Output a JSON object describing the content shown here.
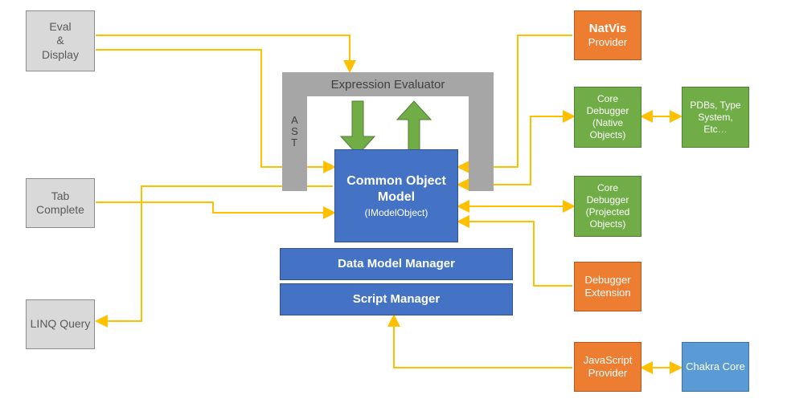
{
  "left": {
    "evalDisplay": "Eval\n&\nDisplay",
    "tabComplete": "Tab Complete",
    "linqQuery": "LINQ Query"
  },
  "center": {
    "expressionEvaluator": "Expression Evaluator",
    "ast": "A\nS\nT",
    "commonObjectModel": "Common Object Model",
    "commonObjectModelSub": "(IModelObject)",
    "dataModelManager": "Data Model Manager",
    "scriptManager": "Script Manager"
  },
  "right": {
    "natvisProvider": "NatVis",
    "natvisProviderLine2": "Provider",
    "coreDebuggerNative": "Core Debugger (Native Objects)",
    "coreDebuggerProjected": "Core Debugger (Projected Objects)",
    "debuggerExtension": "Debugger Extension",
    "javascriptProvider": "JavaScript Provider",
    "pdbs": "PDBs, Type System, Etc…",
    "chakraCore": "Chakra Core"
  },
  "colors": {
    "arrow": "#ffc000",
    "greenArrow": "#548235"
  }
}
